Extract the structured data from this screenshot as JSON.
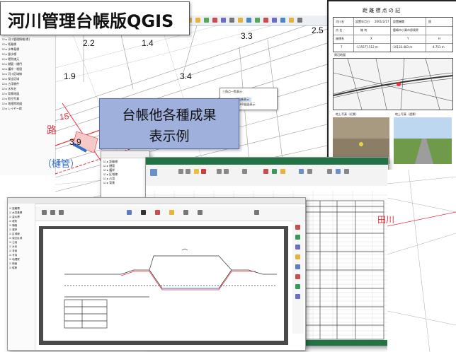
{
  "title_box": {
    "title": "河川管理台帳版QGIS"
  },
  "callout": {
    "line1": "台帳他各種成果",
    "line2": "表示例"
  },
  "map": {
    "labels": [
      "2.2",
      "1.4",
      "3.3",
      "2.5",
      "1.9",
      "3.4",
      "3.9",
      "15"
    ],
    "red_text_1": "路",
    "blue_text": "（樋管）",
    "red_text_2": "田川"
  },
  "popup_menu": {
    "title": "三角点一覧表示",
    "items": [
      "台帳表示",
      "CAD図面表示"
    ]
  },
  "benchmark_card": {
    "title": "距 離 標 点 の 記",
    "row1": [
      "河川名",
      "設置年月日",
      "2001/2/17",
      "設置機関",
      "国"
    ],
    "row2": [
      "点 名",
      "幾 何",
      "鹿嶋市小栗市原境界"
    ],
    "row3_headers": [
      "座標系",
      "X",
      "Y",
      "H"
    ],
    "row4": [
      "7",
      "-115577.512 m",
      "-10133.483 m",
      "4.751 m"
    ],
    "section_location": "周辺地図",
    "section_photo_left": "地上写真（近景）",
    "section_photo_right": "地上写真（遠景）"
  },
  "colors": {
    "accent_red": "#e8313a",
    "callout_bg": "#9fb0dc",
    "excel_green": "#217346",
    "map_blue": "#2f6fd0"
  }
}
